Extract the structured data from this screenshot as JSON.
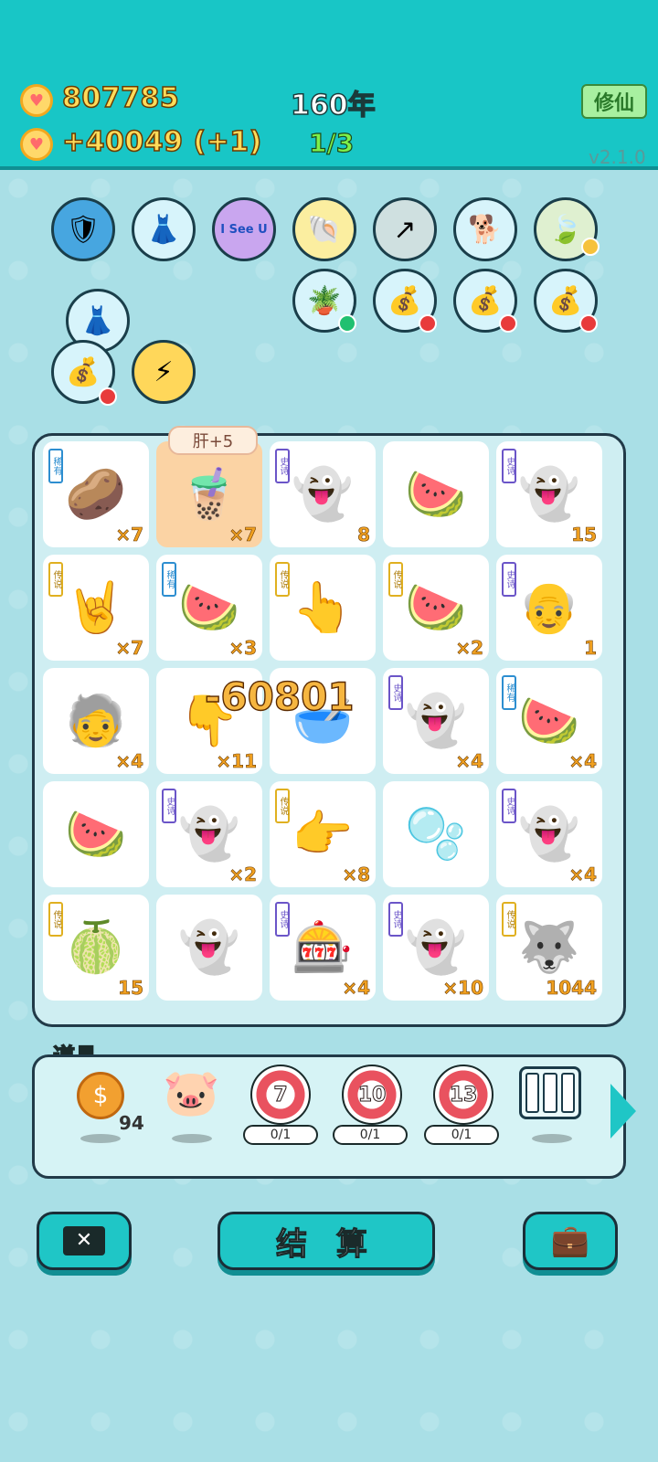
{
  "header": {
    "coins": "807785",
    "income": "+40049 (+1)",
    "year": "160年",
    "round": "1/3",
    "cultivate_label": "修仙",
    "version": "v2.1.0"
  },
  "relics": {
    "row1_icons": [
      "shield-wrench-icon",
      "skirt-icon",
      "i-see-u-icon",
      "shell-icon",
      "arrow-card-icon",
      "dog-icon",
      "leaf-icon"
    ],
    "i_see_u_text": "I See U",
    "row2_icons": [
      "flower-pot-icon",
      "sack-icon",
      "sack-icon",
      "sack-icon"
    ],
    "left_icons": [
      "skirt-icon",
      "sack-icon",
      "lightning-icon"
    ]
  },
  "board": {
    "tooltip": "肝+5",
    "damage_text": "-60801",
    "cells": [
      {
        "icon": "🥔",
        "tag": "稀有",
        "tagc": "blue",
        "count": "×7"
      },
      {
        "icon": "🧋",
        "tag": "",
        "tagc": "",
        "count": "×7",
        "active": true
      },
      {
        "icon": "👻",
        "tag": "史诗",
        "tagc": "",
        "count": "8"
      },
      {
        "icon": "🍉",
        "tag": "",
        "tagc": "",
        "count": ""
      },
      {
        "icon": "👻",
        "tag": "史诗",
        "tagc": "",
        "count": "15"
      },
      {
        "icon": "🤘",
        "tag": "传说",
        "tagc": "yellow",
        "count": "×7"
      },
      {
        "icon": "🍉",
        "tag": "稀有",
        "tagc": "blue",
        "count": "×3"
      },
      {
        "icon": "👆",
        "tag": "传说",
        "tagc": "yellow",
        "count": ""
      },
      {
        "icon": "🍉",
        "tag": "传说",
        "tagc": "yellow",
        "count": "×2"
      },
      {
        "icon": "👴",
        "tag": "史诗",
        "tagc": "",
        "count": "1"
      },
      {
        "icon": "🧓",
        "tag": "",
        "tagc": "",
        "count": "×4"
      },
      {
        "icon": "👇",
        "tag": "",
        "tagc": "",
        "count": "×11"
      },
      {
        "icon": "🥣",
        "tag": "",
        "tagc": "",
        "count": ""
      },
      {
        "icon": "👻",
        "tag": "史诗",
        "tagc": "",
        "count": "×4"
      },
      {
        "icon": "🍉",
        "tag": "稀有",
        "tagc": "blue",
        "count": "×4"
      },
      {
        "icon": "🍉",
        "tag": "",
        "tagc": "",
        "count": ""
      },
      {
        "icon": "👻",
        "tag": "史诗",
        "tagc": "",
        "count": "×2"
      },
      {
        "icon": "👉",
        "tag": "传说",
        "tagc": "yellow",
        "count": "×8"
      },
      {
        "icon": "🫧",
        "tag": "",
        "tagc": "",
        "count": ""
      },
      {
        "icon": "👻",
        "tag": "史诗",
        "tagc": "",
        "count": "×4"
      },
      {
        "icon": "🍈",
        "tag": "传说",
        "tagc": "yellow",
        "count": "15"
      },
      {
        "icon": "👻",
        "tag": "",
        "tagc": "",
        "count": ""
      },
      {
        "icon": "🎰",
        "tag": "史诗",
        "tagc": "",
        "count": "×4"
      },
      {
        "icon": "👻",
        "tag": "史诗",
        "tagc": "",
        "count": "×10"
      },
      {
        "icon": "🐺",
        "tag": "传说",
        "tagc": "yellow",
        "count": "1044"
      }
    ]
  },
  "props": {
    "label": "道具",
    "coin_count": "94",
    "targets": [
      {
        "value": "7",
        "progress": "0/1"
      },
      {
        "value": "10",
        "progress": "0/1"
      },
      {
        "value": "13",
        "progress": "0/1"
      }
    ]
  },
  "actions": {
    "settle_label": "结 算"
  }
}
